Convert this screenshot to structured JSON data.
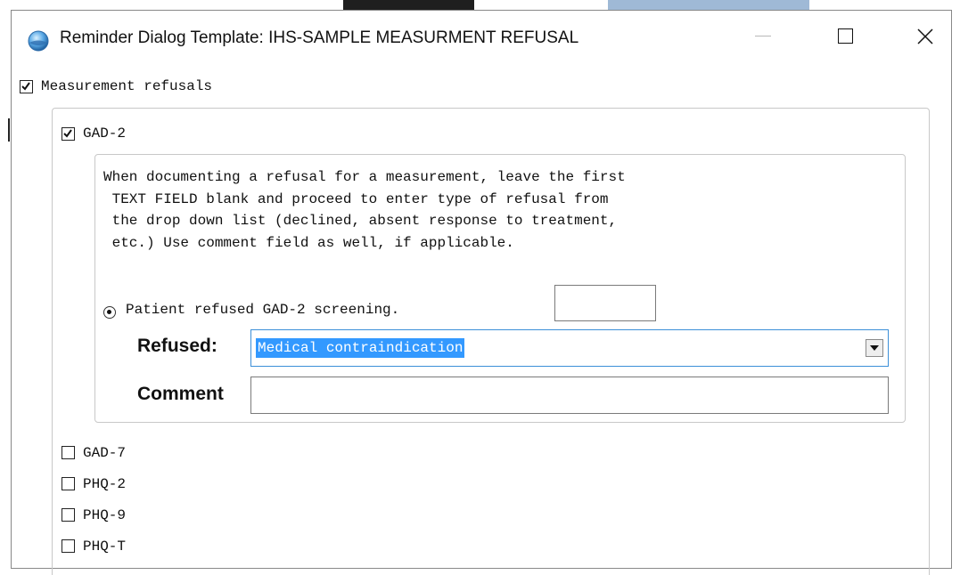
{
  "window": {
    "title": "Reminder Dialog Template: IHS-SAMPLE MEASURMENT REFUSAL",
    "icon": "globe-app-icon"
  },
  "controls": {
    "minimize_icon": "minimize-icon",
    "maximize_icon": "maximize-icon",
    "close_icon": "close-icon"
  },
  "root_item": {
    "label": "Measurement refusals",
    "checked": true
  },
  "gad2": {
    "label": "GAD-2",
    "checked": true,
    "instructions": [
      "When documenting a refusal for a measurement, leave the first",
      " TEXT FIELD blank and proceed to enter type of refusal from",
      " the drop down list (declined, absent response to treatment,",
      " etc.) Use comment field as well, if applicable."
    ],
    "radio_label": "Patient refused GAD-2 screening.",
    "radio_selected": true,
    "text_field_value": "",
    "refused_label": "Refused: ",
    "refused_value": "Medical contraindication",
    "comment_label": "Comment",
    "comment_value": ""
  },
  "other_items": [
    {
      "label": "GAD-7",
      "checked": false
    },
    {
      "label": "PHQ-2",
      "checked": false
    },
    {
      "label": "PHQ-9",
      "checked": false
    },
    {
      "label": "PHQ-T",
      "checked": false
    }
  ],
  "colors": {
    "selection": "#3399ff",
    "focus_border": "#3c8fd8",
    "group_border": "#c8c8c8"
  }
}
